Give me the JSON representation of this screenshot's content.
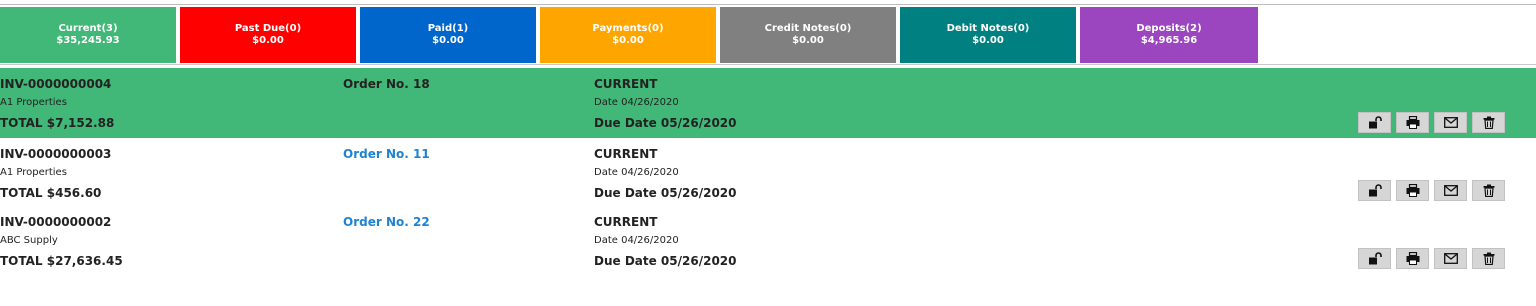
{
  "tabs": [
    {
      "label": "Current(3)",
      "amount": "$35,245.93",
      "color": "#41b877"
    },
    {
      "label": "Past Due(0)",
      "amount": "$0.00",
      "color": "#ff0000"
    },
    {
      "label": "Paid(1)",
      "amount": "$0.00",
      "color": "#0066cc"
    },
    {
      "label": "Payments(0)",
      "amount": "$0.00",
      "color": "#ffa500"
    },
    {
      "label": "Credit Notes(0)",
      "amount": "$0.00",
      "color": "#808080"
    },
    {
      "label": "Debit Notes(0)",
      "amount": "$0.00",
      "color": "#008080"
    },
    {
      "label": "Deposits(2)",
      "amount": "$4,965.96",
      "color": "#9b45bf"
    }
  ],
  "invoices": [
    {
      "number": "INV-0000000004",
      "customer": "A1 Properties",
      "total": "TOTAL $7,152.88",
      "order": "Order No. 18",
      "status": "CURRENT",
      "date": "Date 04/26/2020",
      "due": "Due Date 05/26/2020",
      "selected": true
    },
    {
      "number": "INV-0000000003",
      "customer": "A1 Properties",
      "total": "TOTAL $456.60",
      "order": "Order No. 11",
      "status": "CURRENT",
      "date": "Date 04/26/2020",
      "due": "Due Date 05/26/2020",
      "selected": false
    },
    {
      "number": "INV-0000000002",
      "customer": "ABC Supply",
      "total": "TOTAL $27,636.45",
      "order": "Order No. 22",
      "status": "CURRENT",
      "date": "Date 04/26/2020",
      "due": "Due Date 05/26/2020",
      "selected": false
    }
  ],
  "action_icons": [
    "unlock-icon",
    "print-icon",
    "email-icon",
    "trash-icon"
  ],
  "colors": {
    "selected_row": "#41b877",
    "order_link": "#1f83d1",
    "action_button_bg": "#d6d6d6"
  }
}
